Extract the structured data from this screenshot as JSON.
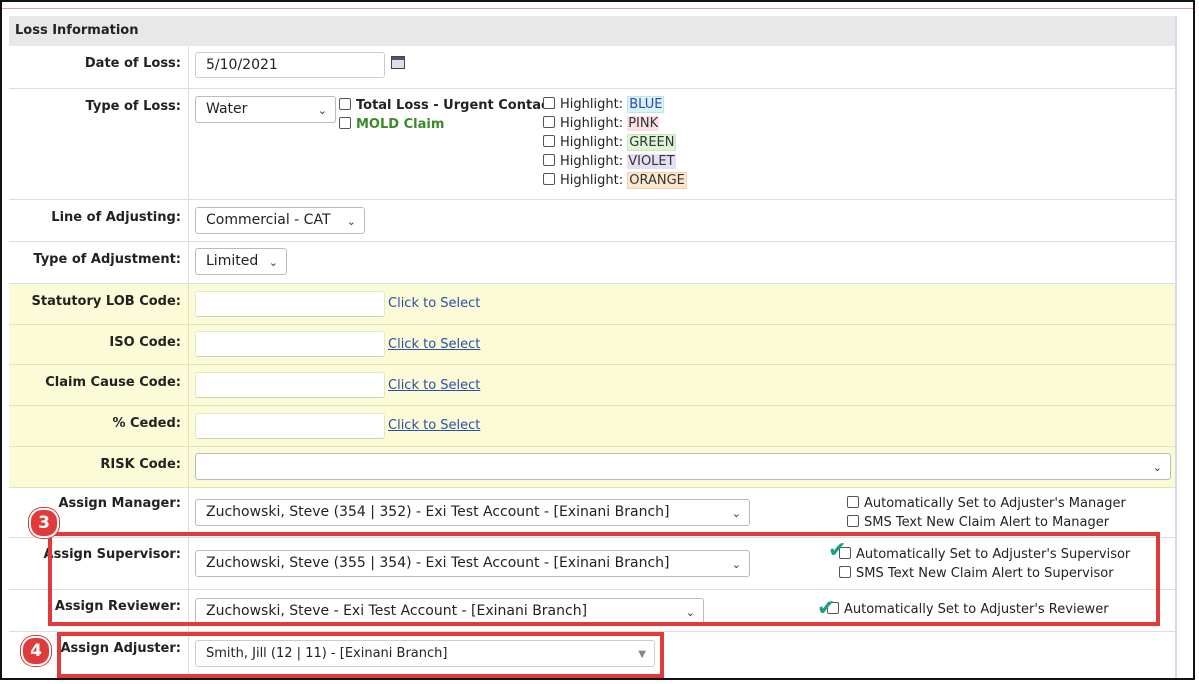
{
  "section_title": "Loss Information",
  "date_of_loss": {
    "label": "Date of Loss:",
    "value": "5/10/2021",
    "icon": "calendar-icon"
  },
  "type_of_loss": {
    "label": "Type of Loss:",
    "value": "Water",
    "total_loss": "Total Loss - Urgent Contact",
    "mold_claim": "MOLD Claim",
    "mold_color": "#3a8a2a",
    "highlight_prefix": "Highlight:",
    "highlights": [
      {
        "name": "BLUE",
        "color": "#d8f2f8"
      },
      {
        "name": "PINK",
        "color": "#fbe0e6"
      },
      {
        "name": "GREEN",
        "color": "#dff5d8"
      },
      {
        "name": "VIOLET",
        "color": "#e6def5"
      },
      {
        "name": "ORANGE",
        "color": "#fde8cf"
      }
    ]
  },
  "line_of_adjusting": {
    "label": "Line of Adjusting:",
    "value": "Commercial - CAT"
  },
  "type_of_adjustment": {
    "label": "Type of Adjustment:",
    "value": "Limited"
  },
  "statutory_lob": {
    "label": "Statutory LOB Code:",
    "link": "Click to Select"
  },
  "iso_code": {
    "label": "ISO Code:",
    "link": "Click to Select"
  },
  "claim_cause": {
    "label": "Claim Cause Code:",
    "link": "Click to Select"
  },
  "ceded": {
    "label": "% Ceded:",
    "link": "Click to Select"
  },
  "risk_code": {
    "label": "RISK Code:",
    "value": ""
  },
  "manager": {
    "label": "Assign Manager:",
    "value": "Zuchowski, Steve (354 | 352) - Exi Test Account - [Exinani Branch]",
    "auto": "Automatically Set to Adjuster's Manager",
    "sms": "SMS Text New Claim Alert to Manager"
  },
  "supervisor": {
    "label": "Assign Supervisor:",
    "value": "Zuchowski, Steve (355 | 354) - Exi Test Account - [Exinani Branch]",
    "auto": "Automatically Set to Adjuster's Supervisor",
    "sms": "SMS Text New Claim Alert to Supervisor"
  },
  "reviewer": {
    "label": "Assign Reviewer:",
    "value": "Zuchowski, Steve - Exi Test Account - [Exinani Branch]",
    "auto": "Automatically Set to Adjuster's Reviewer"
  },
  "adjuster": {
    "label": "Assign Adjuster:",
    "value": "Smith, Jill (12 | 11) - [Exinani Branch]"
  },
  "callouts": {
    "step3": "3",
    "step4": "4",
    "color": "#e03a3a",
    "check_color": "#1aa084"
  }
}
